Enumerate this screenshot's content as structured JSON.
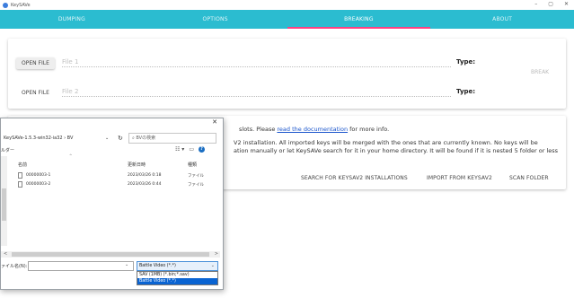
{
  "window": {
    "title": "KeySAVe",
    "controls": [
      "–",
      "▢",
      "✕"
    ]
  },
  "tabs": [
    {
      "label": "DUMPING",
      "active": false
    },
    {
      "label": "OPTIONS",
      "active": false
    },
    {
      "label": "BREAKING",
      "active": true
    },
    {
      "label": "ABOUT",
      "active": false
    }
  ],
  "file_card": {
    "open1": "OPEN FILE",
    "file1_placeholder": "File 1",
    "open2": "OPEN FILE",
    "file2_placeholder": "File 2",
    "type_label": "Type:",
    "break_label": "BREAK"
  },
  "info_card": {
    "line1_prefix": "slots. Please ",
    "line1_link": "read the documentation",
    "line1_suffix": " for more info.",
    "line2": "V2 installation. All imported keys will be merged with the ones that are currently known. No keys will be",
    "line3": "ation manually or let KeySAVe search for it in your home directory. It will be found if it is nested 5 folder or less",
    "buttons": [
      "SEARCH FOR KEYSAV2 INSTALLATIONS",
      "IMPORT FROM KEYSAV2",
      "SCAN FOLDER"
    ]
  },
  "file_dialog": {
    "close": "✕",
    "address": "KeySAVe-1.5.3-win32-ia32  ›  BV",
    "refresh": "↻",
    "search_placeholder": "⌕  BVの検索",
    "folder_label": "ルダー",
    "headers": {
      "name": "名前",
      "date": "更新日時",
      "type": "種類"
    },
    "files": [
      {
        "name": "00000003-1",
        "date": "2023/03/26 0:18",
        "type": "ファイル"
      },
      {
        "name": "00000003-2",
        "date": "2023/03/26 0:44",
        "type": "ファイル"
      }
    ],
    "filename_label": "ァイル名(N):",
    "filename_value": "",
    "filetype_selected": "Battle Video (*.*)",
    "filetype_options": [
      "SAV (1MB) (*.bin;*.sav)",
      "Battle Video (*.*)"
    ],
    "filetype_highlighted": 1
  }
}
